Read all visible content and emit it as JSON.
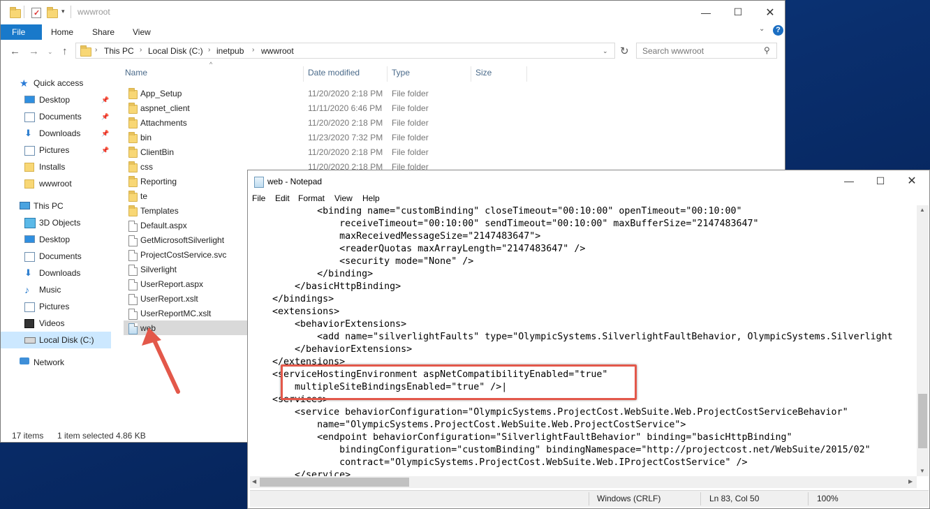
{
  "explorer": {
    "title": "wwwroot",
    "ribbon": {
      "file": "File",
      "home": "Home",
      "share": "Share",
      "view": "View"
    },
    "breadcrumb": [
      "This PC",
      "Local Disk (C:)",
      "inetpub",
      "wwwroot"
    ],
    "search_placeholder": "Search wwwroot",
    "nav": {
      "quick_access": "Quick access",
      "quick_items": [
        "Desktop",
        "Documents",
        "Downloads",
        "Pictures",
        "Installs",
        "wwwroot"
      ],
      "this_pc": "This PC",
      "pc_items": [
        "3D Objects",
        "Desktop",
        "Documents",
        "Downloads",
        "Music",
        "Pictures",
        "Videos",
        "Local Disk (C:)"
      ],
      "network": "Network"
    },
    "columns": {
      "name": "Name",
      "date": "Date modified",
      "type": "Type",
      "size": "Size"
    },
    "files": [
      {
        "name": "App_Setup",
        "date": "11/20/2020 2:18 PM",
        "type": "File folder",
        "kind": "folder"
      },
      {
        "name": "aspnet_client",
        "date": "11/11/2020 6:46 PM",
        "type": "File folder",
        "kind": "folder"
      },
      {
        "name": "Attachments",
        "date": "11/20/2020 2:18 PM",
        "type": "File folder",
        "kind": "folder"
      },
      {
        "name": "bin",
        "date": "11/23/2020 7:32 PM",
        "type": "File folder",
        "kind": "folder"
      },
      {
        "name": "ClientBin",
        "date": "11/20/2020 2:18 PM",
        "type": "File folder",
        "kind": "folder"
      },
      {
        "name": "css",
        "date": "11/20/2020 2:18 PM",
        "type": "File folder",
        "kind": "folder"
      },
      {
        "name": "Reporting",
        "date": "",
        "type": "",
        "kind": "folder"
      },
      {
        "name": "te",
        "date": "",
        "type": "",
        "kind": "folder"
      },
      {
        "name": "Templates",
        "date": "",
        "type": "",
        "kind": "folder"
      },
      {
        "name": "Default.aspx",
        "date": "",
        "type": "",
        "kind": "doc"
      },
      {
        "name": "GetMicrosoftSilverlight",
        "date": "",
        "type": "",
        "kind": "doc"
      },
      {
        "name": "ProjectCostService.svc",
        "date": "",
        "type": "",
        "kind": "doc"
      },
      {
        "name": "Silverlight",
        "date": "",
        "type": "",
        "kind": "doc"
      },
      {
        "name": "UserReport.aspx",
        "date": "",
        "type": "",
        "kind": "doc"
      },
      {
        "name": "UserReport.xslt",
        "date": "",
        "type": "",
        "kind": "doc"
      },
      {
        "name": "UserReportMC.xslt",
        "date": "",
        "type": "",
        "kind": "doc"
      },
      {
        "name": "web",
        "date": "",
        "type": "",
        "kind": "config"
      }
    ],
    "status": {
      "count": "17 items",
      "selected": "1 item selected",
      "size": "4.86 KB"
    }
  },
  "notepad": {
    "title": "web - Notepad",
    "menu": [
      "File",
      "Edit",
      "Format",
      "View",
      "Help"
    ],
    "lines": [
      "            <binding name=\"customBinding\" closeTimeout=\"00:10:00\" openTimeout=\"00:10:00\"",
      "                receiveTimeout=\"00:10:00\" sendTimeout=\"00:10:00\" maxBufferSize=\"2147483647\"",
      "                maxReceivedMessageSize=\"2147483647\">",
      "                <readerQuotas maxArrayLength=\"2147483647\" />",
      "                <security mode=\"None\" />",
      "            </binding>",
      "        </basicHttpBinding>",
      "    </bindings>",
      "    <extensions>",
      "        <behaviorExtensions>",
      "            <add name=\"silverlightFaults\" type=\"OlympicSystems.SilverlightFaultBehavior, OlympicSystems.Silverlight",
      "        </behaviorExtensions>",
      "    </extensions>",
      "    <serviceHostingEnvironment aspNetCompatibilityEnabled=\"true\"",
      "        multipleSiteBindingsEnabled=\"true\" />|",
      "    <services>",
      "        <service behaviorConfiguration=\"OlympicSystems.ProjectCost.WebSuite.Web.ProjectCostServiceBehavior\"",
      "            name=\"OlympicSystems.ProjectCost.WebSuite.Web.ProjectCostService\">",
      "            <endpoint behaviorConfiguration=\"SilverlightFaultBehavior\" binding=\"basicHttpBinding\"",
      "                bindingConfiguration=\"customBinding\" bindingNamespace=\"http://projectcost.net/WebSuite/2015/02\"",
      "                contract=\"OlympicSystems.ProjectCost.WebSuite.Web.IProjectCostService\" />",
      "        </service>"
    ],
    "status": {
      "eol": "Windows (CRLF)",
      "position": "Ln 83, Col 50",
      "zoom": "100%"
    }
  }
}
